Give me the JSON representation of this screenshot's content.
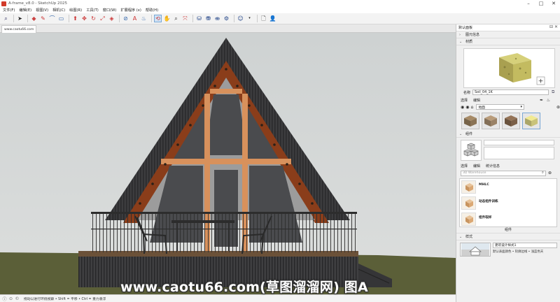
{
  "window": {
    "title": "A-frame_v8.0 - SketchUp 2025"
  },
  "menu": [
    "文件(F)",
    "编辑(E)",
    "视图(V)",
    "相机(C)",
    "绘图(R)",
    "工具(T)",
    "窗口(W)",
    "扩展程序 (x)",
    "帮助(H)"
  ],
  "document_tab": "www.caotu66.com",
  "statusbar": {
    "text": "拖动以进行环绕视察 • Shift = 平移 • Ctrl = 重力悬浮"
  },
  "watermark": "www.caotu66.com(草图溜溜网) 图A",
  "tray": {
    "title": "默认面板",
    "sections": {
      "entity_info": "图元信息",
      "materials": "材质",
      "components": "组件",
      "styles": "样式"
    },
    "material": {
      "name_label": "名称",
      "name_value": "Soil_04_1K",
      "tabs": [
        "选择",
        "编辑"
      ],
      "library": "地面",
      "swatch_colors": [
        "#8b7456",
        "#9a8266",
        "#7b6048",
        "#c9c37a"
      ]
    },
    "components": {
      "tabs": [
        "选择",
        "编辑",
        "统计信息"
      ],
      "search_placeholder": "3D Warehouse",
      "items": [
        "MHLC",
        "动态组件训练",
        "组件取样"
      ],
      "footer": "组件"
    },
    "style": {
      "name": "建筑设计样式1",
      "description": "默认表面颜色 • 轮廓边线 • 浅蓝色天"
    }
  },
  "colors": {
    "accent": "#7aa7d4",
    "sky": "#d5d8d8",
    "ground": "#5a5e37"
  }
}
